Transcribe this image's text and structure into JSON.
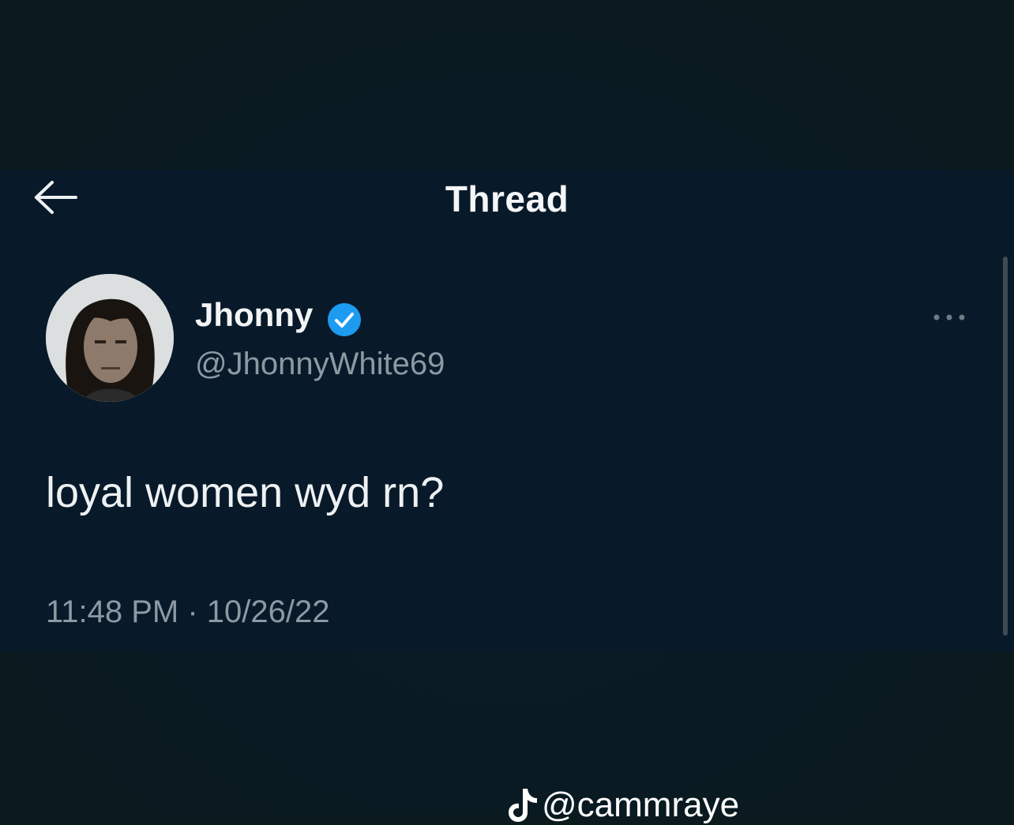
{
  "header": {
    "title": "Thread",
    "back_icon": "arrow-left-icon"
  },
  "tweet": {
    "author": {
      "display_name": "Jhonny",
      "handle": "@JhonnyWhite69",
      "verified": true,
      "verified_color": "#1d9bf0"
    },
    "text": "loyal women wyd rn?",
    "timestamp": "11:48 PM · 10/26/22",
    "more_icon": "ellipsis-icon"
  },
  "watermark": {
    "platform_icon": "tiktok-icon",
    "text": "@cammraye"
  },
  "colors": {
    "background": "#0b1a1c",
    "panel": "#081a29",
    "secondary_text": "#8d99a3"
  }
}
